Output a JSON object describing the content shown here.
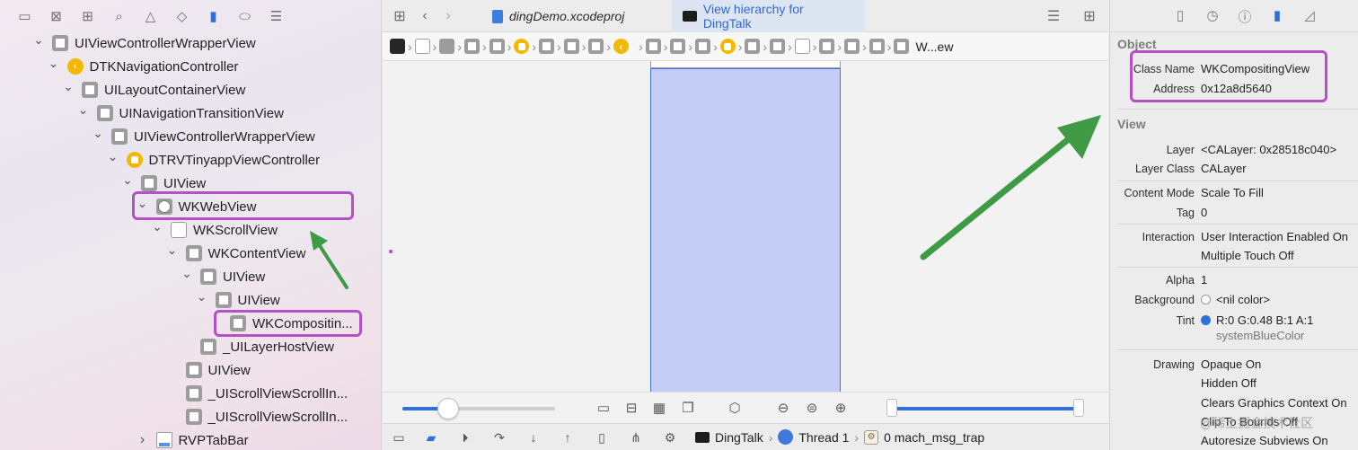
{
  "navigator": {
    "toolbar_icons": [
      "folder-icon",
      "close-square-icon",
      "hierarchy-icon",
      "search-icon",
      "warning-icon",
      "diamond-icon",
      "spray-icon",
      "tag-icon",
      "list-icon"
    ],
    "tree": [
      {
        "label": "UIViewControllerWrapperView",
        "indent": 0,
        "chev": "down",
        "icon": "view-box-icon"
      },
      {
        "label": "DTKNavigationController",
        "indent": 1,
        "chev": "down",
        "icon": "nav-controller-icon"
      },
      {
        "label": "UILayoutContainerView",
        "indent": 2,
        "chev": "down",
        "icon": "view-box-icon"
      },
      {
        "label": "UINavigationTransitionView",
        "indent": 3,
        "chev": "down",
        "icon": "view-box-icon"
      },
      {
        "label": "UIViewControllerWrapperView",
        "indent": 4,
        "chev": "down",
        "icon": "view-box-icon"
      },
      {
        "label": "DTRVTinyappViewController",
        "indent": 5,
        "chev": "down",
        "icon": "view-controller-icon"
      },
      {
        "label": "UIView",
        "indent": 6,
        "chev": "down",
        "icon": "view-box-icon"
      },
      {
        "label": "WKWebView",
        "indent": 7,
        "chev": "down",
        "icon": "safari-icon"
      },
      {
        "label": "WKScrollView",
        "indent": 8,
        "chev": "down",
        "icon": "scroll-view-icon"
      },
      {
        "label": "WKContentView",
        "indent": 9,
        "chev": "down",
        "icon": "view-box-icon"
      },
      {
        "label": "UIView",
        "indent": 10,
        "chev": "down",
        "icon": "view-box-icon"
      },
      {
        "label": "UIView",
        "indent": 11,
        "chev": "down",
        "icon": "view-box-icon"
      },
      {
        "label": "WKCompositin...",
        "indent": 12,
        "chev": "none",
        "icon": "view-box-icon"
      },
      {
        "label": "_UILayerHostView",
        "indent": 10,
        "chev": "none",
        "icon": "view-box-icon"
      },
      {
        "label": "UIView",
        "indent": 9,
        "chev": "none",
        "icon": "view-box-icon"
      },
      {
        "label": "_UIScrollViewScrollIn...",
        "indent": 9,
        "chev": "none",
        "icon": "view-box-icon"
      },
      {
        "label": "_UIScrollViewScrollIn...",
        "indent": 9,
        "chev": "none",
        "icon": "view-box-icon"
      },
      {
        "label": "RVPTabBar",
        "indent": 7,
        "chev": "right",
        "icon": "tab-bar-icon"
      }
    ]
  },
  "editor": {
    "tabs": [
      {
        "label": "dingDemo.xcodeproj",
        "active": false
      },
      {
        "label": "View hierarchy for DingTalk",
        "active": true
      }
    ],
    "breadcrumb_end": "W...ew",
    "zoom_slider_value": 0.3,
    "range_slider": [
      0.0,
      1.0
    ]
  },
  "debug_bar": {
    "app": "DingTalk",
    "thread": "Thread 1",
    "frame": "0 mach_msg_trap"
  },
  "inspector": {
    "object_title": "Object",
    "class_name_label": "Class Name",
    "class_name": "WKCompositingView",
    "address_label": "Address",
    "address": "0x12a8d5640",
    "view_title": "View",
    "layer_label": "Layer",
    "layer": "<CALayer: 0x28518c040>",
    "layer_class_label": "Layer Class",
    "layer_class": "CALayer",
    "content_mode_label": "Content Mode",
    "content_mode": "Scale To Fill",
    "tag_label": "Tag",
    "tag": "0",
    "interaction_label": "Interaction",
    "interaction_1": "User Interaction Enabled On",
    "interaction_2": "Multiple Touch Off",
    "alpha_label": "Alpha",
    "alpha": "1",
    "background_label": "Background",
    "background": "<nil color>",
    "tint_label": "Tint",
    "tint": "R:0 G:0.48 B:1 A:1",
    "tint_name": "systemBlueColor",
    "tint_color": "#2f6fdf",
    "drawing_label": "Drawing",
    "drawing_1": "Opaque On",
    "drawing_2": "Hidden Off",
    "drawing_3": "Clears Graphics Context On",
    "drawing_4": "Clip To Bounds Off",
    "drawing_5": "Autoresize Subviews On"
  },
  "watermark": "@稀土掘金技术社区",
  "colors": {
    "highlight": "#b451c4",
    "arrow": "#3f9a45",
    "selection_fill": "#c5ccf6",
    "accent": "#2f6fdf"
  }
}
